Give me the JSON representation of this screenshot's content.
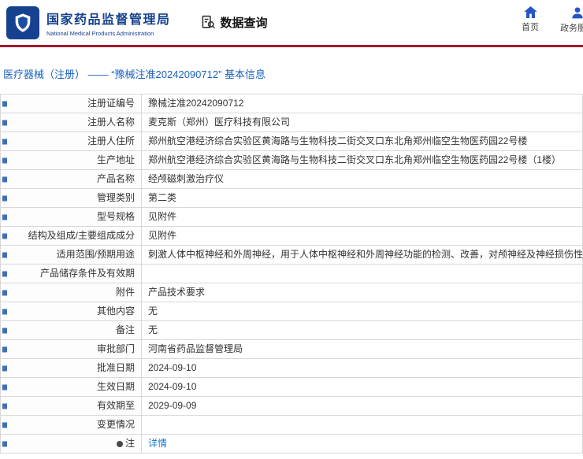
{
  "header": {
    "logo": {
      "title": "国家药品监督管理局",
      "subtitle": "National Medical Products Administration"
    },
    "section": "数据查询",
    "nav": [
      {
        "label": "首页",
        "icon": "home-icon"
      },
      {
        "label": "政务服务",
        "icon": "user-icon"
      }
    ]
  },
  "breadcrumb": {
    "text": "医疗器械（注册） —— “豫械注准20242090712” 基本信息"
  },
  "table": {
    "rows": [
      {
        "label": "注册证编号",
        "value": "豫械注准20242090712"
      },
      {
        "label": "注册人名称",
        "value": "麦克斯（郑州）医疗科技有限公司"
      },
      {
        "label": "注册人住所",
        "value": "郑州航空港经济综合实验区黄海路与生物科技二街交叉口东北角郑州临空生物医药园22号楼"
      },
      {
        "label": "生产地址",
        "value": "郑州航空港经济综合实验区黄海路与生物科技二街交叉口东北角郑州临空生物医药园22号楼（1楼）"
      },
      {
        "label": "产品名称",
        "value": "经颅磁刺激治疗仪"
      },
      {
        "label": "管理类别",
        "value": "第二类"
      },
      {
        "label": "型号规格",
        "value": "见附件"
      },
      {
        "label": "结构及组成/主要组成成分",
        "value": "见附件"
      },
      {
        "label": "适用范围/预期用途",
        "value": "刺激人体中枢神经和外周神经，用于人体中枢神经和外周神经功能的检测、改善，对颅神经及神经损伤性疾病的辅助治疗。"
      },
      {
        "label": "产品储存条件及有效期",
        "value": ""
      },
      {
        "label": "附件",
        "value": "产品技术要求"
      },
      {
        "label": "其他内容",
        "value": "无"
      },
      {
        "label": "备注",
        "value": "无"
      },
      {
        "label": "审批部门",
        "value": "河南省药品监督管理局"
      },
      {
        "label": "批准日期",
        "value": "2024-09-10"
      },
      {
        "label": "生效日期",
        "value": "2024-09-10"
      },
      {
        "label": "有效期至",
        "value": "2029-09-09"
      },
      {
        "label": "变更情况",
        "value": ""
      },
      {
        "label": "注",
        "value": "详情",
        "link": true,
        "note_icon": true
      }
    ]
  },
  "colors": {
    "header_blue": "#16418e",
    "red_line": "#a6192e",
    "breadcrumb_blue": "#1b62c1",
    "link_blue": "#1a74d2",
    "marker_blue": "#3f6fb5",
    "nav_icon_blue": "#2257c5"
  }
}
